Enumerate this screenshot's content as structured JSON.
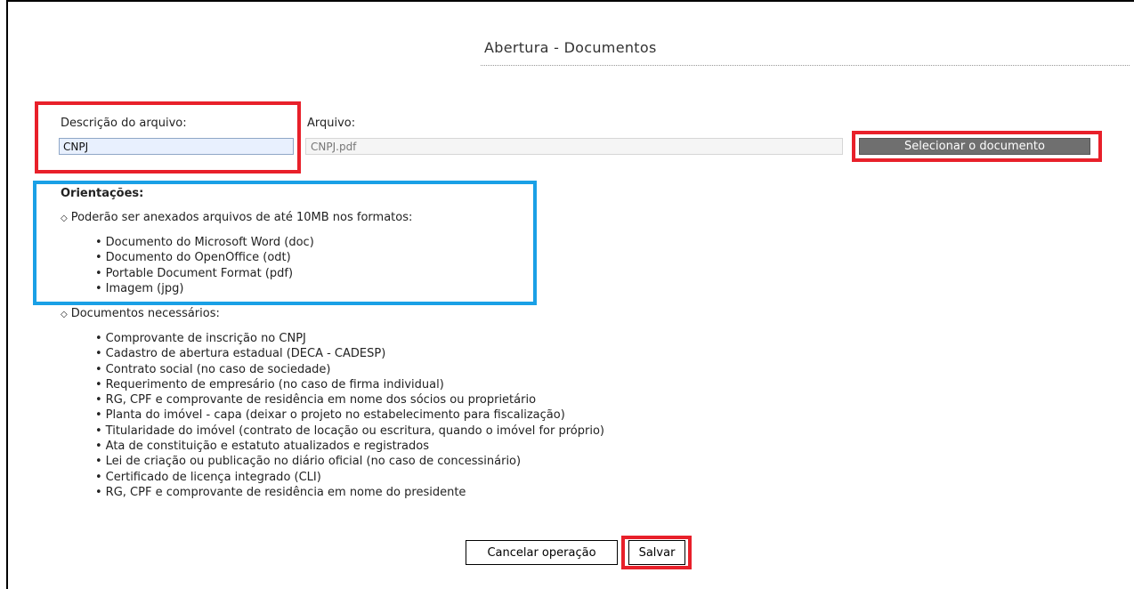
{
  "page": {
    "title": "Abertura - Documentos"
  },
  "form": {
    "description_label": "Descrição do arquivo:",
    "description_value": "CNPJ",
    "file_label": "Arquivo:",
    "file_value": "CNPJ.pdf",
    "select_button": "Selecionar o documento"
  },
  "guidance": {
    "heading": "Orientações:",
    "formats_intro": "Poderão ser anexados arquivos de até 10MB nos formatos:",
    "formats": [
      "Documento do Microsoft Word (doc)",
      "Documento do OpenOffice (odt)",
      "Portable Document Format (pdf)",
      "Imagem (jpg)"
    ],
    "required_intro": "Documentos necessários:",
    "required": [
      "Comprovante de inscrição no CNPJ",
      "Cadastro de abertura estadual (DECA - CADESP)",
      "Contrato social (no caso de sociedade)",
      "Requerimento de empresário (no caso de firma individual)",
      "RG, CPF e comprovante de residência em nome dos sócios ou proprietário",
      "Planta do imóvel - capa (deixar o projeto no estabelecimento para fiscalização)",
      "Titularidade do imóvel (contrato de locação ou escritura, quando o imóvel for próprio)",
      "Ata de constituição e estatuto atualizados e registrados",
      "Lei de criação ou publicação no diário oficial (no caso de concessinário)",
      "Certificado de licença integrado (CLI)",
      "RG, CPF e comprovante de residência em nome do presidente"
    ]
  },
  "actions": {
    "cancel": "Cancelar operação",
    "save": "Salvar"
  },
  "colors": {
    "highlight_red": "#e8202a",
    "highlight_blue": "#1aa0e6",
    "select_button_bg": "#6f6f6f"
  }
}
